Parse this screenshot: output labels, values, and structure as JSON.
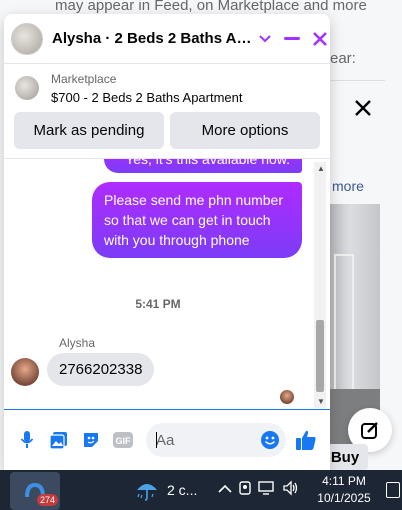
{
  "background": {
    "top_text": "may appear in Feed, on Marketplace and more",
    "partial_label": "ear:",
    "see_more": "more",
    "buy_label": "Buy"
  },
  "chat": {
    "title": "Alysha · 2 Beds 2 Baths Apartment",
    "marketplace_label": "Marketplace",
    "listing": "$700 - 2 Beds 2 Baths Apartment",
    "buttons": {
      "mark_pending": "Mark as pending",
      "more_options": "More options"
    },
    "messages": {
      "outgoing_1": "Yes, it's this available now.",
      "outgoing_2": "Please send me  phn number so that we can get in touch with you through phone",
      "timestamp": "5:41 PM",
      "sender_name": "Alysha",
      "incoming_1": "2766202338"
    },
    "composer": {
      "placeholder": "Aa"
    },
    "colors": {
      "accent": "#a033ff",
      "bubble_gradient_top": "#b02bff",
      "bubble_gradient_bottom": "#7b3cf7",
      "icon_blue": "#1877f2"
    }
  },
  "taskbar": {
    "app_badge": "274",
    "weather": "2 c...",
    "time": "4:11 PM",
    "date": "10/1/2025"
  }
}
